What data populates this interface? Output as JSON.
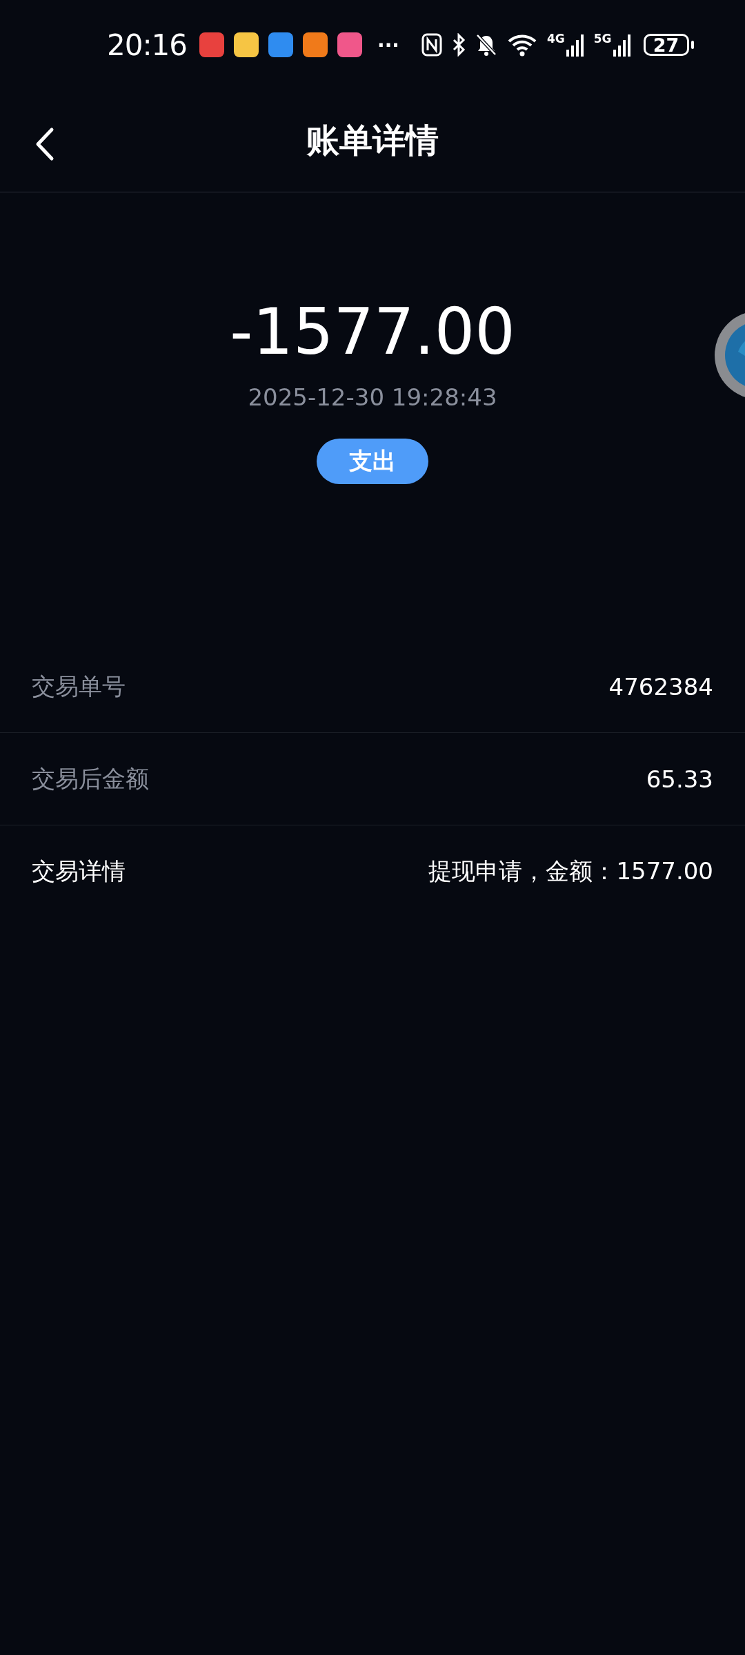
{
  "status_bar": {
    "time": "20:16",
    "notification_apps": [
      {
        "color": "#e8413e"
      },
      {
        "color": "#f6c544"
      },
      {
        "color": "#2f8cf0"
      },
      {
        "color": "#f07a1a"
      },
      {
        "color": "#f0578a"
      }
    ],
    "overflow": "···",
    "networks": [
      "4G",
      "5G"
    ],
    "battery": "27"
  },
  "header": {
    "title": "账单详情"
  },
  "summary": {
    "amount": "-1577.00",
    "time": "2025-12-30 19:28:43",
    "type_badge": "支出"
  },
  "details": [
    {
      "label": "交易单号",
      "value": "4762384",
      "emphasized": false
    },
    {
      "label": "交易后金额",
      "value": "65.33",
      "emphasized": false
    },
    {
      "label": "交易详情",
      "value": "提现申请，金额：1577.00",
      "emphasized": true
    }
  ]
}
